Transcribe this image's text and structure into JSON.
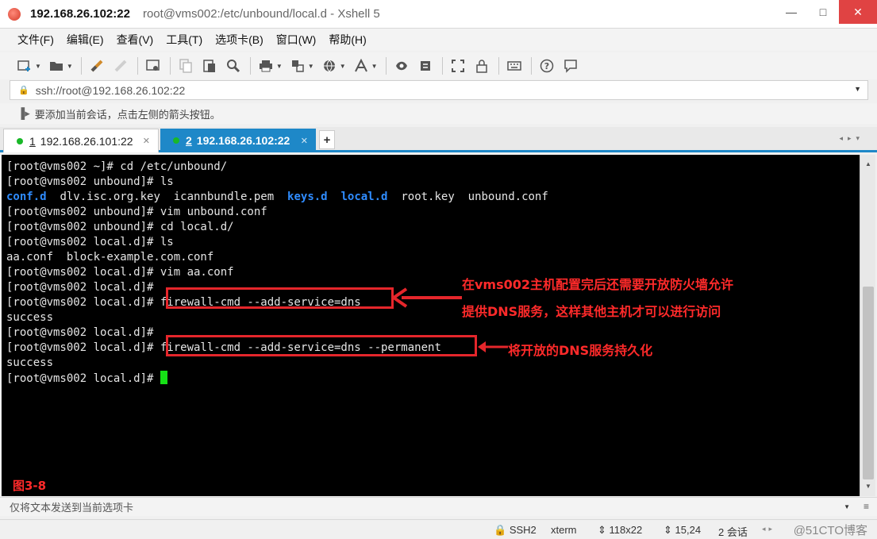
{
  "titlebar": {
    "host": "192.168.26.102:22",
    "title": "root@vms002:/etc/unbound/local.d - Xshell 5",
    "minimize": "—",
    "maximize": "□",
    "close": "✕"
  },
  "menu": {
    "items": [
      "文件(F)",
      "编辑(E)",
      "查看(V)",
      "工具(T)",
      "选项卡(B)",
      "窗口(W)",
      "帮助(H)"
    ]
  },
  "address": {
    "value": "ssh://root@192.168.26.102:22"
  },
  "hint": {
    "text": "要添加当前会话，点击左侧的箭头按钮。"
  },
  "tabs": [
    {
      "num": "1",
      "label": "192.168.26.101:22",
      "status_color": "#19b828"
    },
    {
      "num": "2",
      "label": "192.168.26.102:22",
      "status_color": "#19b828"
    }
  ],
  "terminal": {
    "lines": [
      "[root@vms002 ~]# cd /etc/unbound/",
      "[root@vms002 unbound]# ls",
      "LS_ROW",
      "[root@vms002 unbound]# vim unbound.conf",
      "[root@vms002 unbound]# cd local.d/",
      "[root@vms002 local.d]# ls",
      "aa.conf  block-example.com.conf",
      "[root@vms002 local.d]# vim aa.conf",
      "[root@vms002 local.d]#",
      "[root@vms002 local.d]# firewall-cmd --add-service=dns",
      "success",
      "[root@vms002 local.d]#",
      "[root@vms002 local.d]# firewall-cmd --add-service=dns --permanent",
      "success",
      "[root@vms002 local.d]# "
    ],
    "ls_items": [
      {
        "name": "conf.d",
        "dir": true
      },
      {
        "name": "dlv.isc.org.key",
        "dir": false
      },
      {
        "name": "icannbundle.pem",
        "dir": false
      },
      {
        "name": "keys.d",
        "dir": true
      },
      {
        "name": "local.d",
        "dir": true
      },
      {
        "name": "root.key",
        "dir": false
      },
      {
        "name": "unbound.conf",
        "dir": false
      }
    ]
  },
  "annotations": {
    "note1_line1": "在vms002主机配置完后还需要开放防火墙允许",
    "note1_line2": "提供DNS服务，这样其他主机才可以进行访问",
    "note2": "将开放的DNS服务持久化",
    "figure": "图3-8",
    "color": "#e5262b"
  },
  "sendbar": {
    "placeholder": "仅将文本发送到当前选项卡"
  },
  "status": {
    "protocol": "SSH2",
    "term": "xterm",
    "size": "118x22",
    "pos": "15,24",
    "sessions": "2 会话",
    "watermark": "@51CTO博客"
  }
}
